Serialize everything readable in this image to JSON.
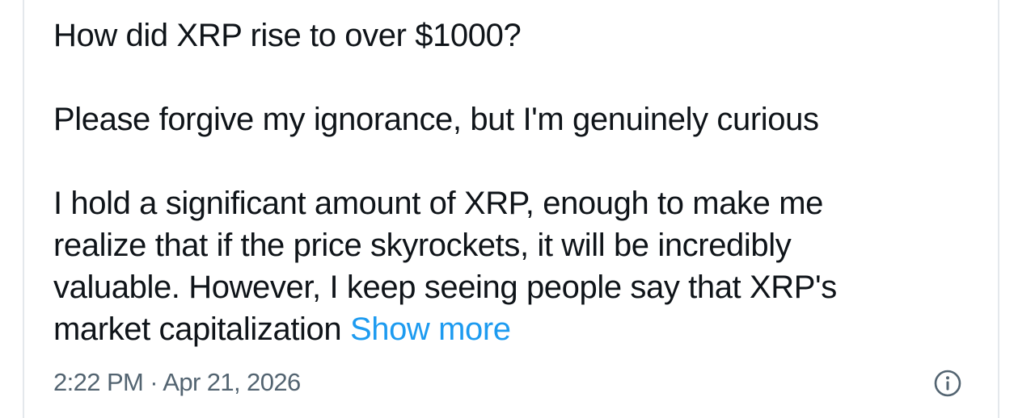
{
  "tweet": {
    "question": "How did XRP rise to over $1000?",
    "apology": "Please forgive my ignorance, but I'm genuinely curious",
    "body_lines": [
      "I hold a significant amount of XRP, enough to make me",
      "realize that if the price skyrockets, it will be incredibly",
      "valuable. However, I keep seeing people say that XRP's",
      "market capitalization"
    ],
    "show_more_label": "Show more",
    "timestamp": "2:22 PM · Apr 21, 2026"
  },
  "icons": {
    "info": "info-circle-icon"
  },
  "colors": {
    "text": "#0f1419",
    "link": "#1d9bf0",
    "muted": "#536471",
    "border": "#e4e8ec"
  }
}
